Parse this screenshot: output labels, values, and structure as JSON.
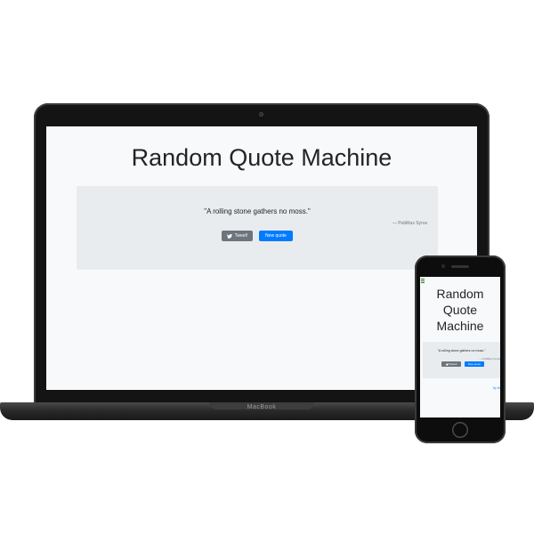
{
  "device": {
    "laptop_brand": "MacBook"
  },
  "app": {
    "title": "Random Quote Machine",
    "title_mobile_lines": [
      "Random",
      "Quote",
      "Machine"
    ],
    "quote": "\"A rolling stone gathers no moss.\"",
    "author": "— Publilius Syrus",
    "author_mobile": "— Publilius Syrus",
    "tweet_label": "Tweet!",
    "tweet_icon": "twitter-icon",
    "new_quote_label": "New quote",
    "footer_mobile": "by Ki",
    "colors": {
      "card": "#e9ecef",
      "tweet_button": "#6c757d",
      "new_quote_button": "#007bff",
      "page_bg": "#f8f9fa"
    }
  }
}
